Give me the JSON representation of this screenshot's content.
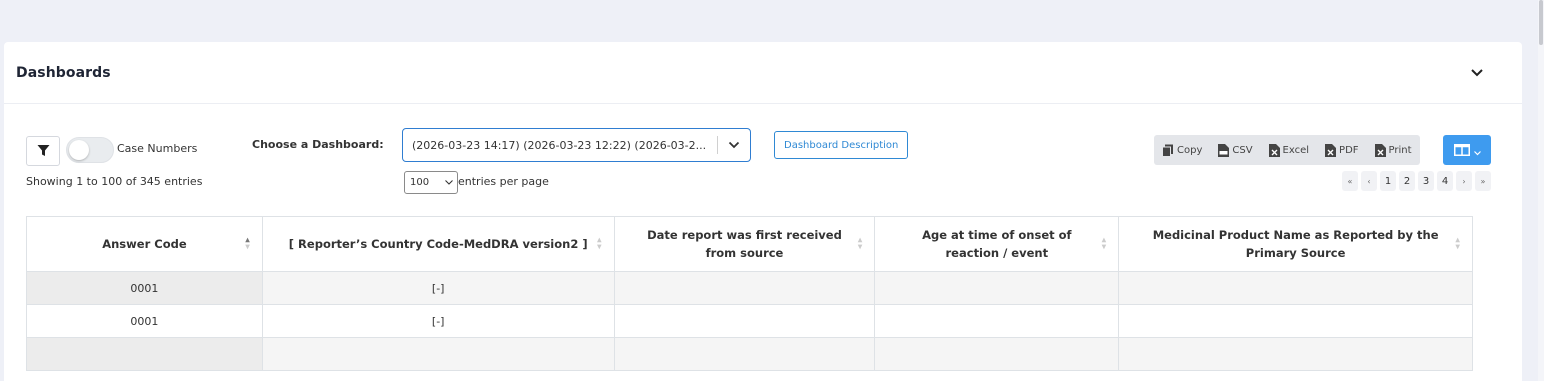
{
  "card": {
    "title": "Dashboards"
  },
  "chooser": {
    "label": "Choose a Dashboard:",
    "selected": "(2026-03-23 14:17) (2026-03-23 12:22) (2026-03-2...",
    "description_button": "Dashboard Description"
  },
  "toolbar": {
    "toggle_label": "Case Numbers",
    "exports": [
      {
        "label": "Copy",
        "icon": "copy-icon"
      },
      {
        "label": "CSV",
        "icon": "csv-file-icon"
      },
      {
        "label": "Excel",
        "icon": "excel-file-icon"
      },
      {
        "label": "PDF",
        "icon": "pdf-file-icon"
      },
      {
        "label": "Print",
        "icon": "print-file-icon"
      }
    ],
    "column_visibility_icon": "columns-icon"
  },
  "table_info": {
    "showing": "Showing 1 to 100 of 345 entries",
    "page_length": "100",
    "page_length_label": "entries per page"
  },
  "pagination": {
    "first": "«",
    "prev": "‹",
    "pages": [
      "1",
      "2",
      "3",
      "4"
    ],
    "next": "›",
    "last": "»"
  },
  "table": {
    "columns": [
      "Answer Code",
      "[ Reporter’s Country Code-MedDRA version2 ]",
      "Date report was first received from source",
      "Age at time of onset of reaction / event",
      "Medicinal Product Name as Reported by the Primary Source"
    ],
    "rows": [
      [
        "0001",
        "[-]",
        "",
        "",
        ""
      ],
      [
        "0001",
        "[-]",
        "",
        "",
        ""
      ]
    ]
  },
  "colors": {
    "accent": "#3e9bef",
    "select_border": "#2f7dd1",
    "background": "#eef0f7"
  }
}
